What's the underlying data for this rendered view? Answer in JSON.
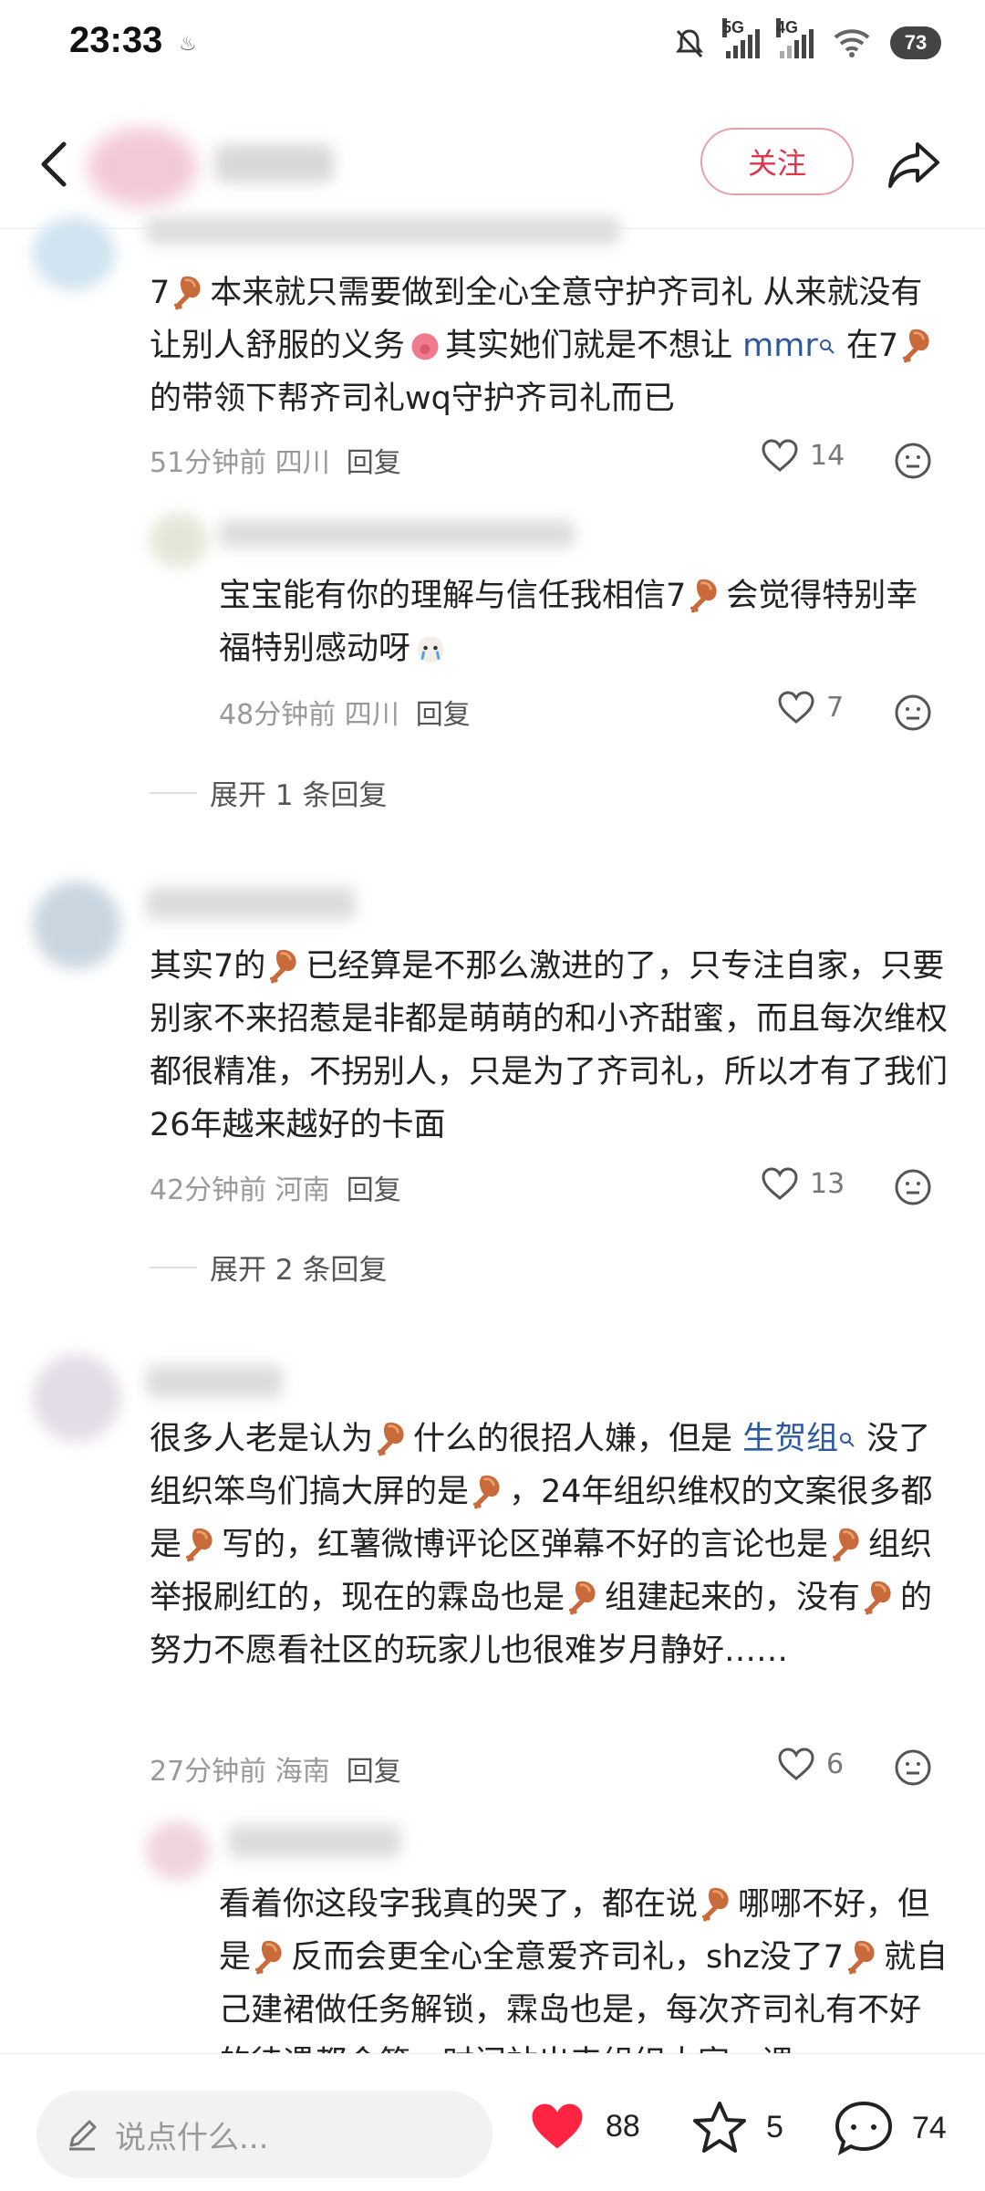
{
  "status_bar": {
    "time": "23:33",
    "network_1": "5G",
    "network_2": "4G",
    "battery": "73"
  },
  "header": {
    "follow_label": "关注"
  },
  "comments": [
    {
      "meta": "51分钟前 四川",
      "reply": "回复",
      "likes": "14"
    },
    {
      "meta": "48分钟前 四川",
      "reply": "回复",
      "likes": "7",
      "expand": "展开 1 条回复"
    },
    {
      "meta": "42分钟前 河南",
      "reply": "回复",
      "likes": "13",
      "expand": "展开 2 条回复"
    },
    {
      "meta": "27分钟前 海南",
      "reply": "回复",
      "likes": "6"
    }
  ],
  "bottom_bar": {
    "input_placeholder": "说点什么...",
    "likes": "88",
    "favorites": "5",
    "comments": "74"
  },
  "colors": {
    "accent": "#e0344b",
    "heart": "#ff2442"
  }
}
